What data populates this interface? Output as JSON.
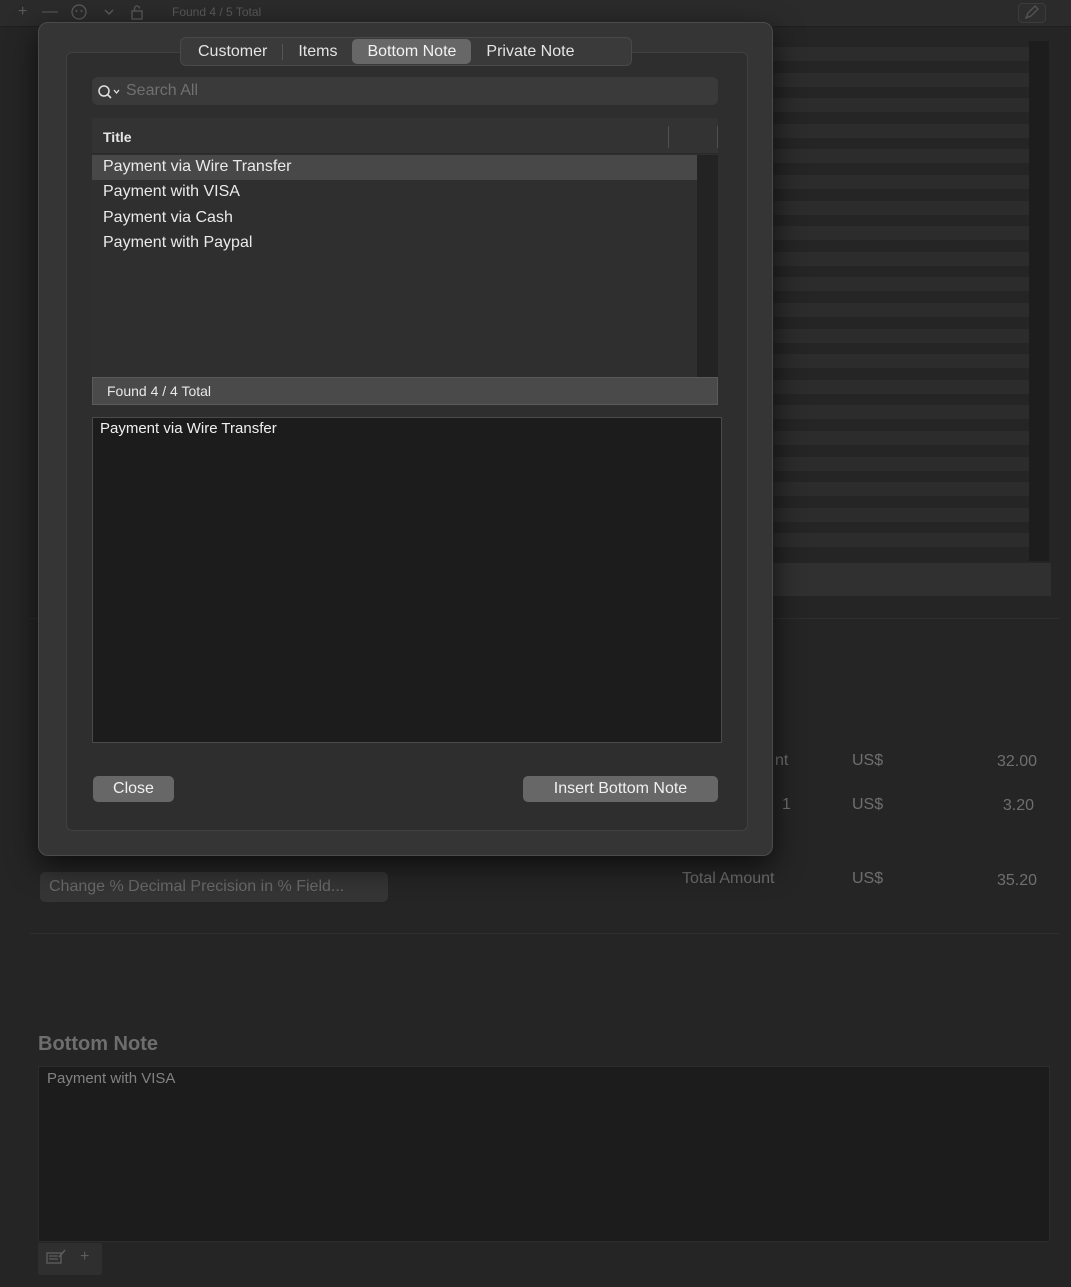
{
  "toolbar": {
    "found_label": "Found 4 / 5 Total",
    "add_glyph": "+",
    "remove_glyph": "—",
    "icons": [
      "plus-icon",
      "minus-icon",
      "emoji-icon",
      "chevron-down-icon",
      "lock-icon",
      "edit-icon"
    ]
  },
  "summary": {
    "rows": [
      {
        "label": "nt",
        "currency": "US$",
        "value": "32.00"
      },
      {
        "label": "1",
        "currency": "US$",
        "value": "3.20"
      },
      {
        "label": "Total Amount",
        "currency": "US$",
        "value": "35.20"
      }
    ]
  },
  "precision_button": "Change % Decimal Precision in % Field...",
  "bottom_note": {
    "heading": "Bottom Note",
    "text": "Payment with VISA",
    "plus_glyph": "+"
  },
  "sheet": {
    "tabs": [
      {
        "label": "Customer",
        "active": false
      },
      {
        "label": "Items",
        "active": false
      },
      {
        "label": "Bottom Note",
        "active": true
      },
      {
        "label": "Private Note",
        "active": false
      }
    ],
    "search": {
      "placeholder": "Search All",
      "value": ""
    },
    "table": {
      "column_title": "Title",
      "rows": [
        {
          "title": "Payment via Wire Transfer",
          "selected": true
        },
        {
          "title": "Payment with VISA",
          "selected": false
        },
        {
          "title": "Payment via Cash",
          "selected": false
        },
        {
          "title": "Payment with Paypal",
          "selected": false
        }
      ]
    },
    "found_label": "Found 4 / 4 Total",
    "preview_text": "Payment via Wire Transfer",
    "close_button": "Close",
    "insert_button": "Insert Bottom Note"
  },
  "colors": {
    "window_bg": "#252525",
    "sheet_bg": "#353535",
    "selected_tab": "#676767",
    "selected_row": "#484848",
    "button_bg": "#676767"
  }
}
